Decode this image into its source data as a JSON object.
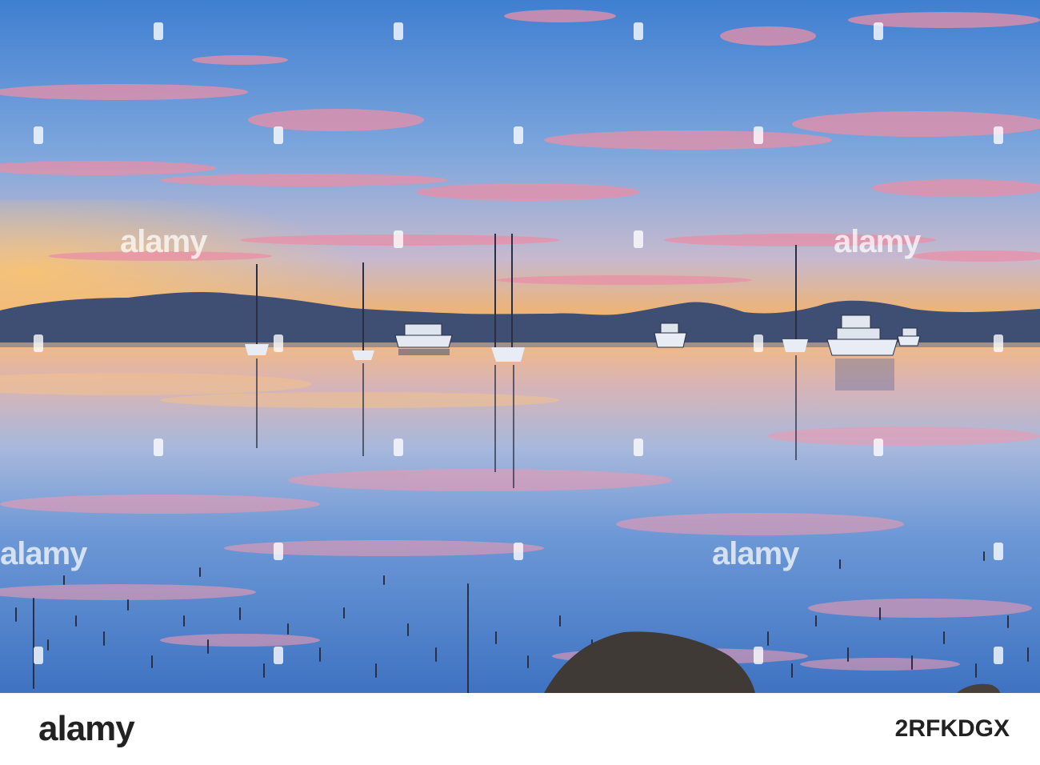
{
  "watermark": {
    "text": "alamy"
  },
  "footer": {
    "logo": "alamy",
    "image_code": "2RFKDGX"
  },
  "colors": {
    "sky_top": "#3f7fd1",
    "sky_mid": "#8fb3e4",
    "horizon_glow": "#f2b06a",
    "cloud_pink": "#e98fa6",
    "hills": "#3d4f72",
    "water_blue": "#4f86d1",
    "rock": "#3f3a36"
  }
}
